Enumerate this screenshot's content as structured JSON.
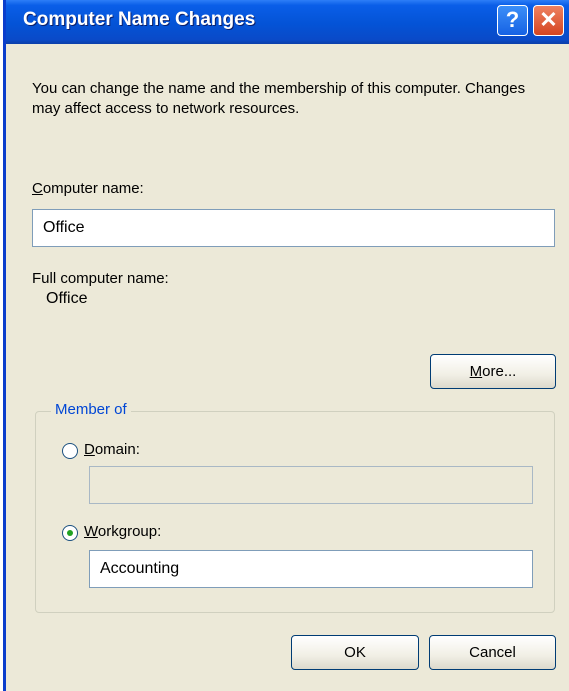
{
  "window": {
    "title": "Computer Name Changes",
    "help_glyph": "?",
    "close_glyph": "✕"
  },
  "description": "You can change the name and the membership of this computer. Changes may affect access to network resources.",
  "computer_name": {
    "label_mnemonic": "C",
    "label_rest": "omputer name:",
    "value": "Office"
  },
  "full_name": {
    "label": "Full computer name:",
    "value": "Office"
  },
  "more_button": {
    "mnemonic": "M",
    "rest": "ore..."
  },
  "member_of": {
    "title": "Member of",
    "domain": {
      "label_mnemonic": "D",
      "label_rest": "omain:",
      "selected": false,
      "value": ""
    },
    "workgroup": {
      "label_mnemonic": "W",
      "label_rest": "orkgroup:",
      "selected": true,
      "value": "Accounting"
    }
  },
  "buttons": {
    "ok": "OK",
    "cancel": "Cancel"
  },
  "colors": {
    "titlebar": "#0453d6",
    "dialog_bg": "#ece9d8",
    "group_title": "#0046d5",
    "radio_dot": "#21a121"
  }
}
